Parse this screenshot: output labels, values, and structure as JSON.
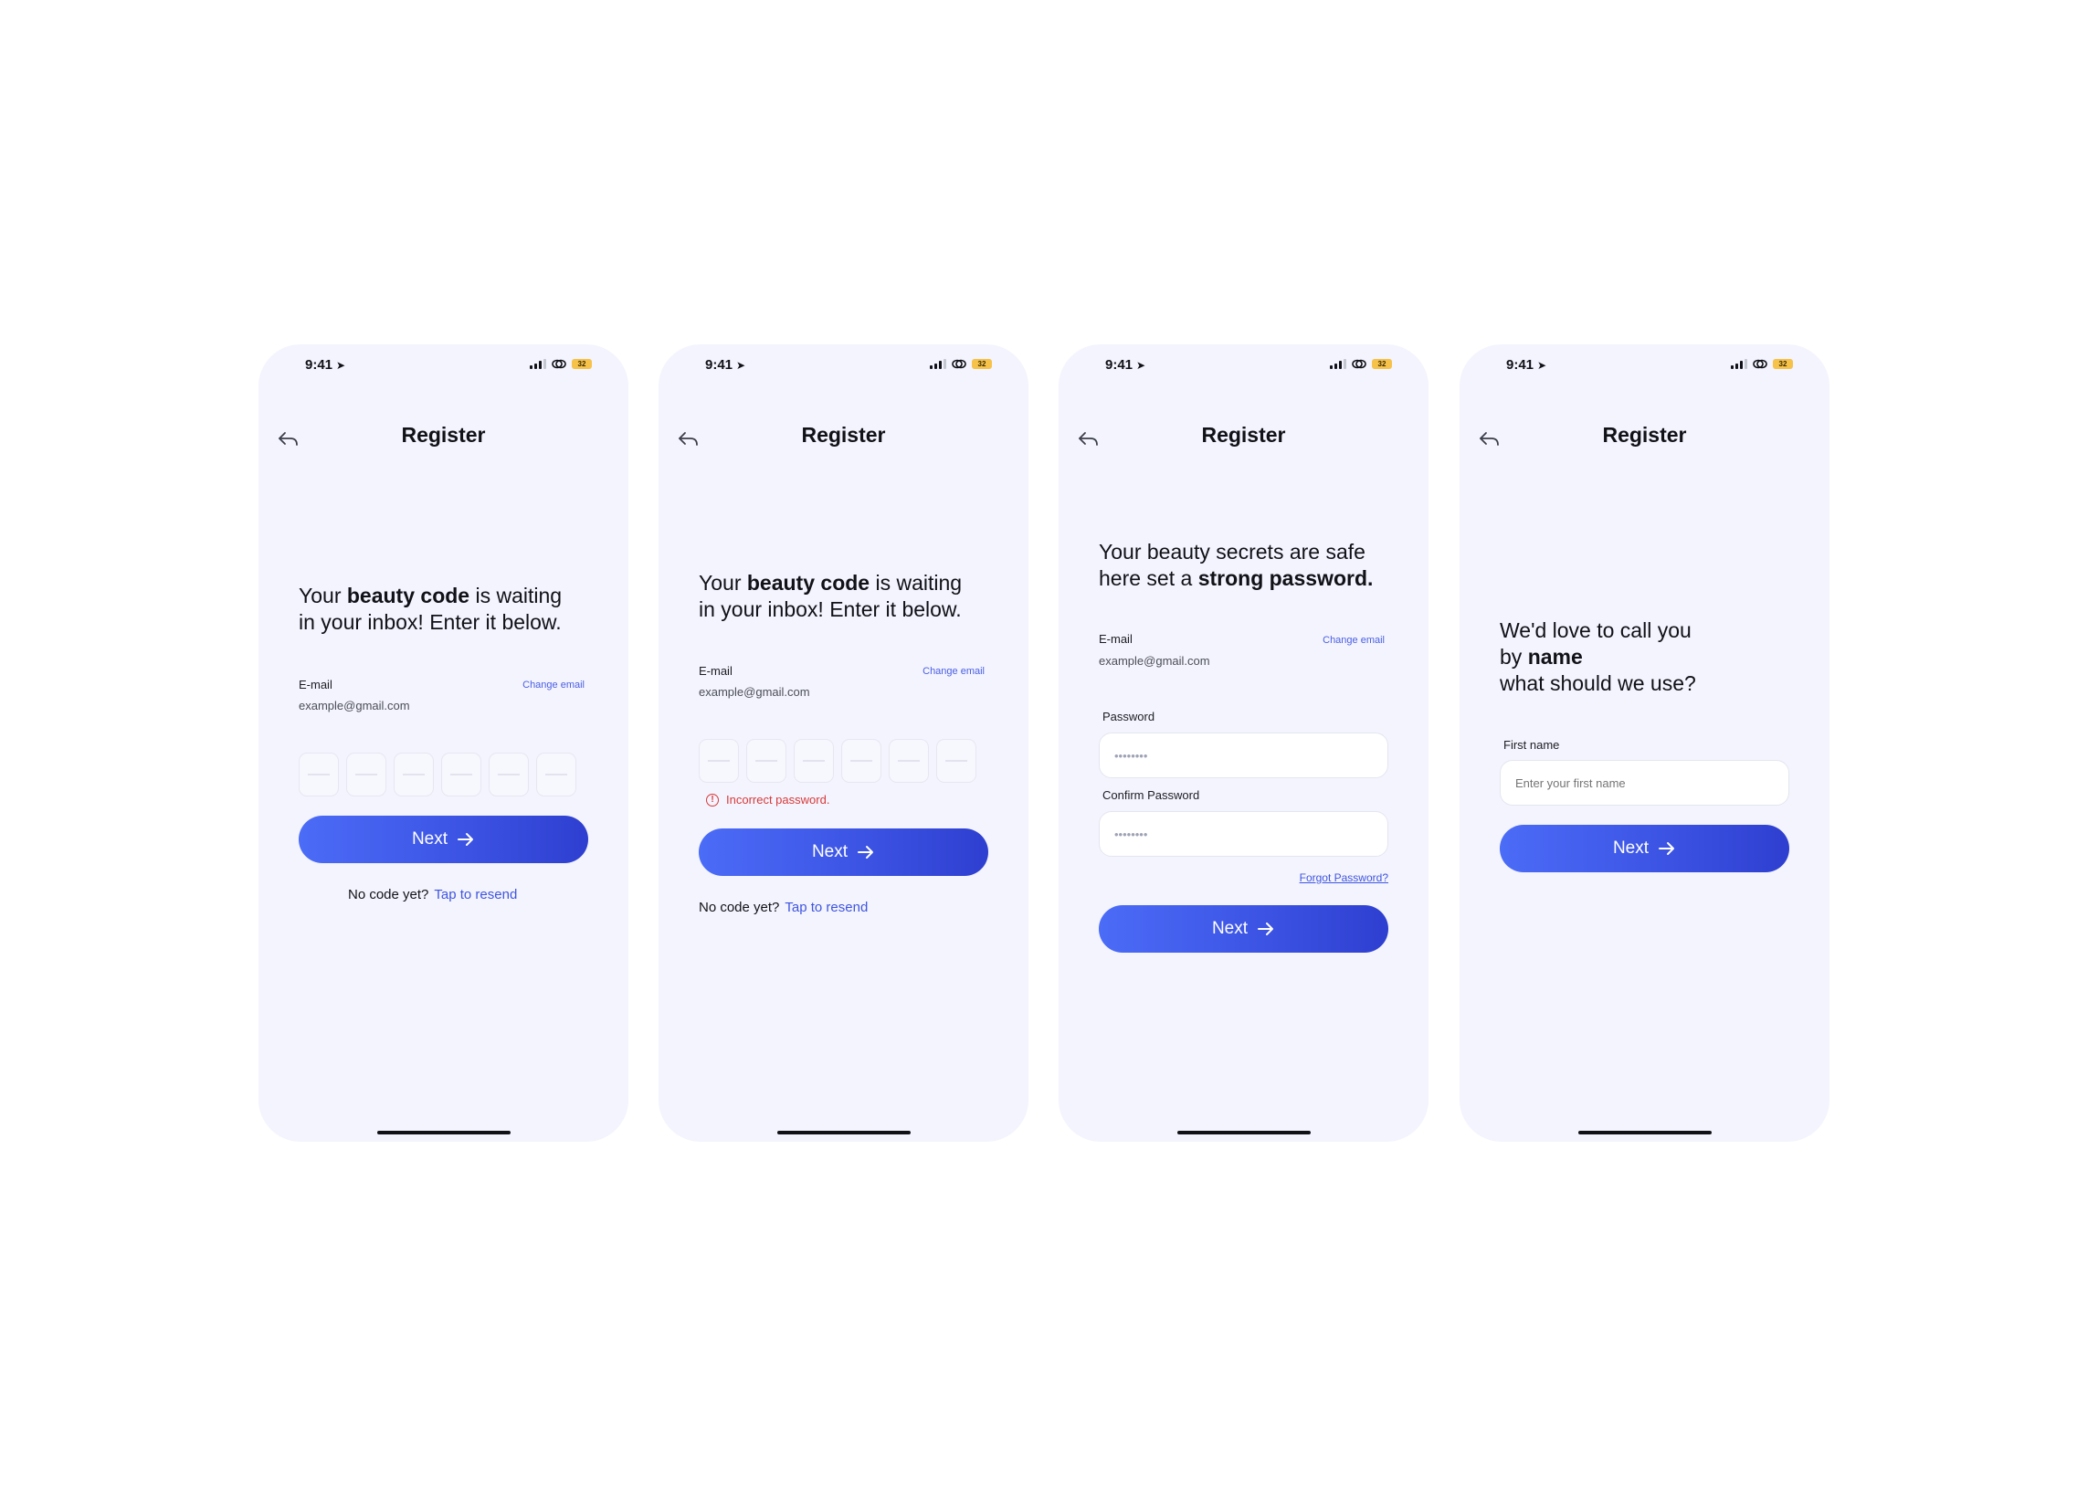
{
  "screens": [
    {
      "status": {
        "time": "9:41",
        "battery": "32"
      },
      "title": "Register",
      "headline": {
        "p1": "Your ",
        "b1": "beauty code",
        "p2": " is waiting",
        "p3": "in your inbox!  Enter it below."
      },
      "email_label": "E-mail",
      "email_value": "example@gmail.com",
      "change_email": "Change email",
      "next_label": "Next",
      "resend_text": "No code yet?",
      "resend_link": "Tap to resend"
    },
    {
      "status": {
        "time": "9:41",
        "battery": "32"
      },
      "title": "Register",
      "headline": {
        "p1": "Your ",
        "b1": "beauty code",
        "p2": " is waiting",
        "p3": "in your inbox!  Enter it below."
      },
      "email_label": "E-mail",
      "email_value": "example@gmail.com",
      "change_email": "Change email",
      "error": "Incorrect password.",
      "next_label": "Next",
      "resend_text": "No code yet?",
      "resend_link": "Tap to resend"
    },
    {
      "status": {
        "time": "9:41",
        "battery": "32"
      },
      "title": "Register",
      "headline": {
        "l1": "Your beauty secrets are safe",
        "p2": "here set a ",
        "b2": "strong password."
      },
      "email_label": "E-mail",
      "email_value": "example@gmail.com",
      "change_email": "Change email",
      "password_label": "Password",
      "password_value": "••••••••",
      "confirm_label": "Confirm Password",
      "confirm_value": "••••••••",
      "forgot": "Forgot Password?",
      "next_label": "Next"
    },
    {
      "status": {
        "time": "9:41",
        "battery": "32"
      },
      "title": "Register",
      "headline": {
        "l1": "We'd love to call you",
        "p2": "by ",
        "b2": "name",
        "l3": "what should we use?"
      },
      "first_name_label": "First name",
      "first_name_placeholder": "Enter your first name",
      "next_label": "Next"
    }
  ]
}
